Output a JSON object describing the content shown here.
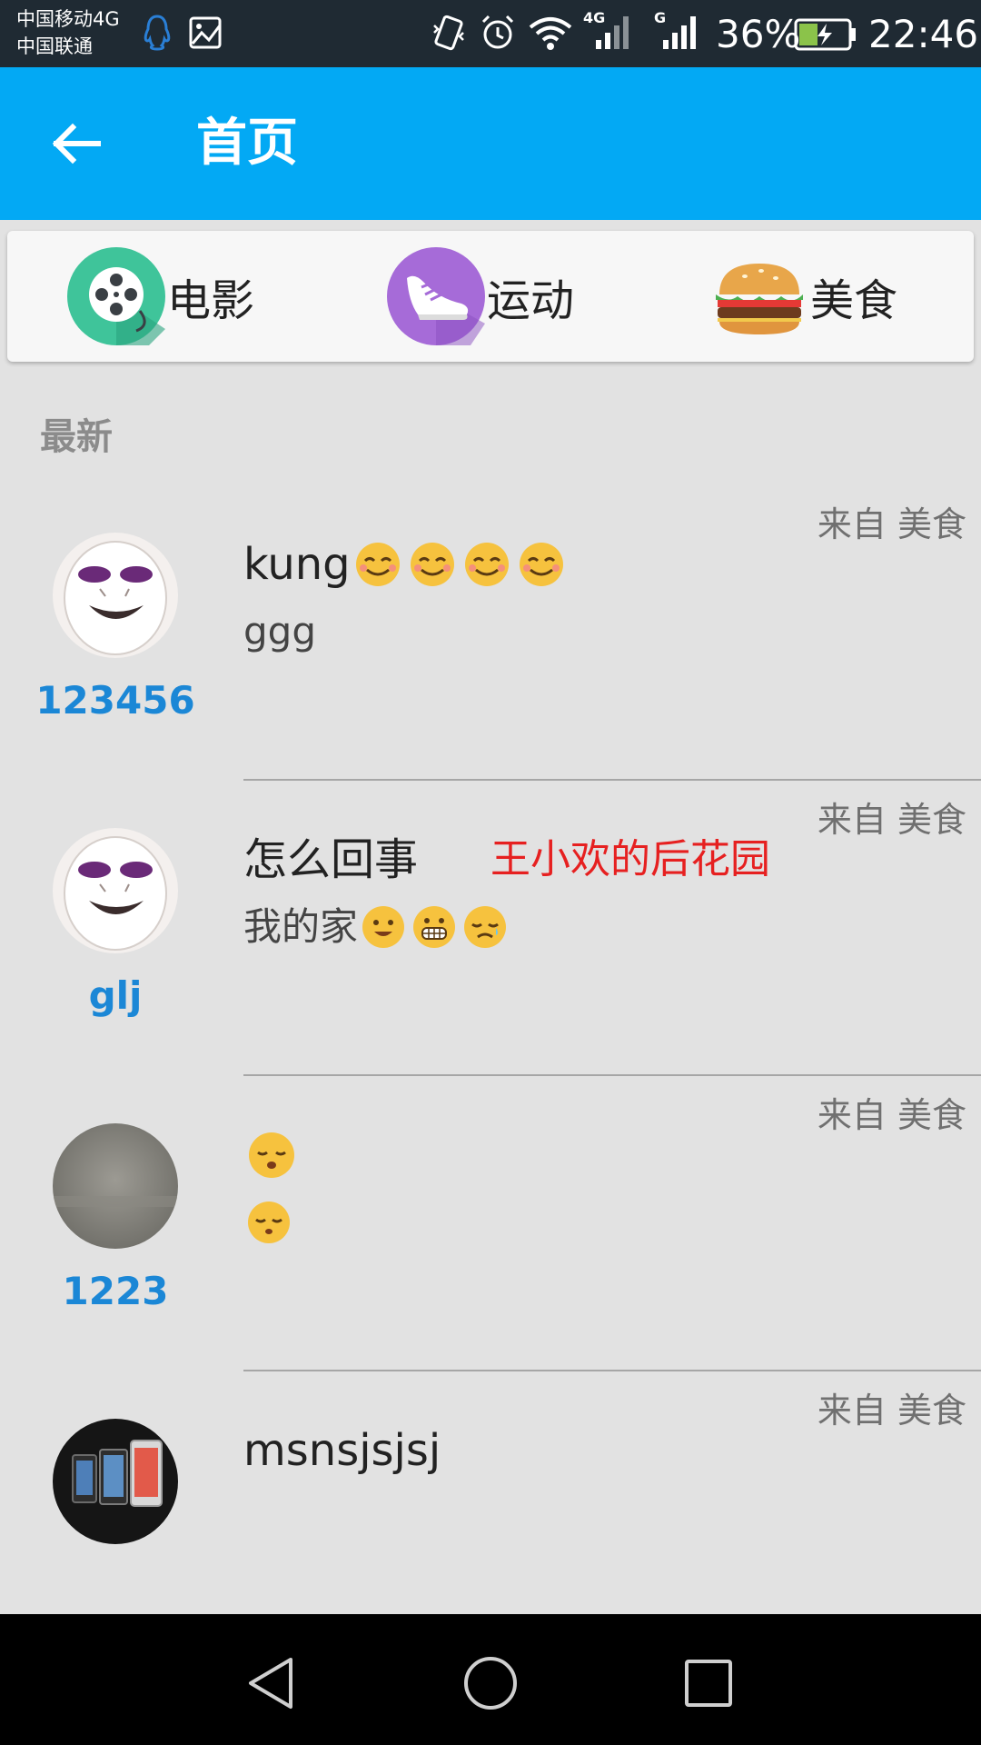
{
  "status_bar": {
    "carrier_1": "中国移动4G",
    "carrier_2": "中国联通",
    "net_1": "4G",
    "net_2": "G",
    "battery": "36%",
    "time": "22:46"
  },
  "app_bar": {
    "title": "首页"
  },
  "categories": [
    {
      "label": "电影",
      "icon": "film-reel-icon"
    },
    {
      "label": "运动",
      "icon": "sneaker-icon"
    },
    {
      "label": "美食",
      "icon": "hamburger-icon"
    }
  ],
  "section": {
    "title": "最新"
  },
  "posts": [
    {
      "source": "来自 美食",
      "username": "123456",
      "title": "kung",
      "body": "ggg",
      "tag": ""
    },
    {
      "source": "来自 美食",
      "username": "glj",
      "title": "怎么回事",
      "body": "我的家",
      "tag": "王小欢的后花园"
    },
    {
      "source": "来自 美食",
      "username": "1223",
      "title": "",
      "body": "",
      "tag": ""
    },
    {
      "source": "来自 美食",
      "username": "",
      "title": "msnsjsjsj",
      "body": "",
      "tag": ""
    }
  ],
  "colors": {
    "app_bar": "#03a9f4",
    "username": "#1b87d6",
    "tag": "#e62020",
    "background": "#e2e2e2"
  }
}
